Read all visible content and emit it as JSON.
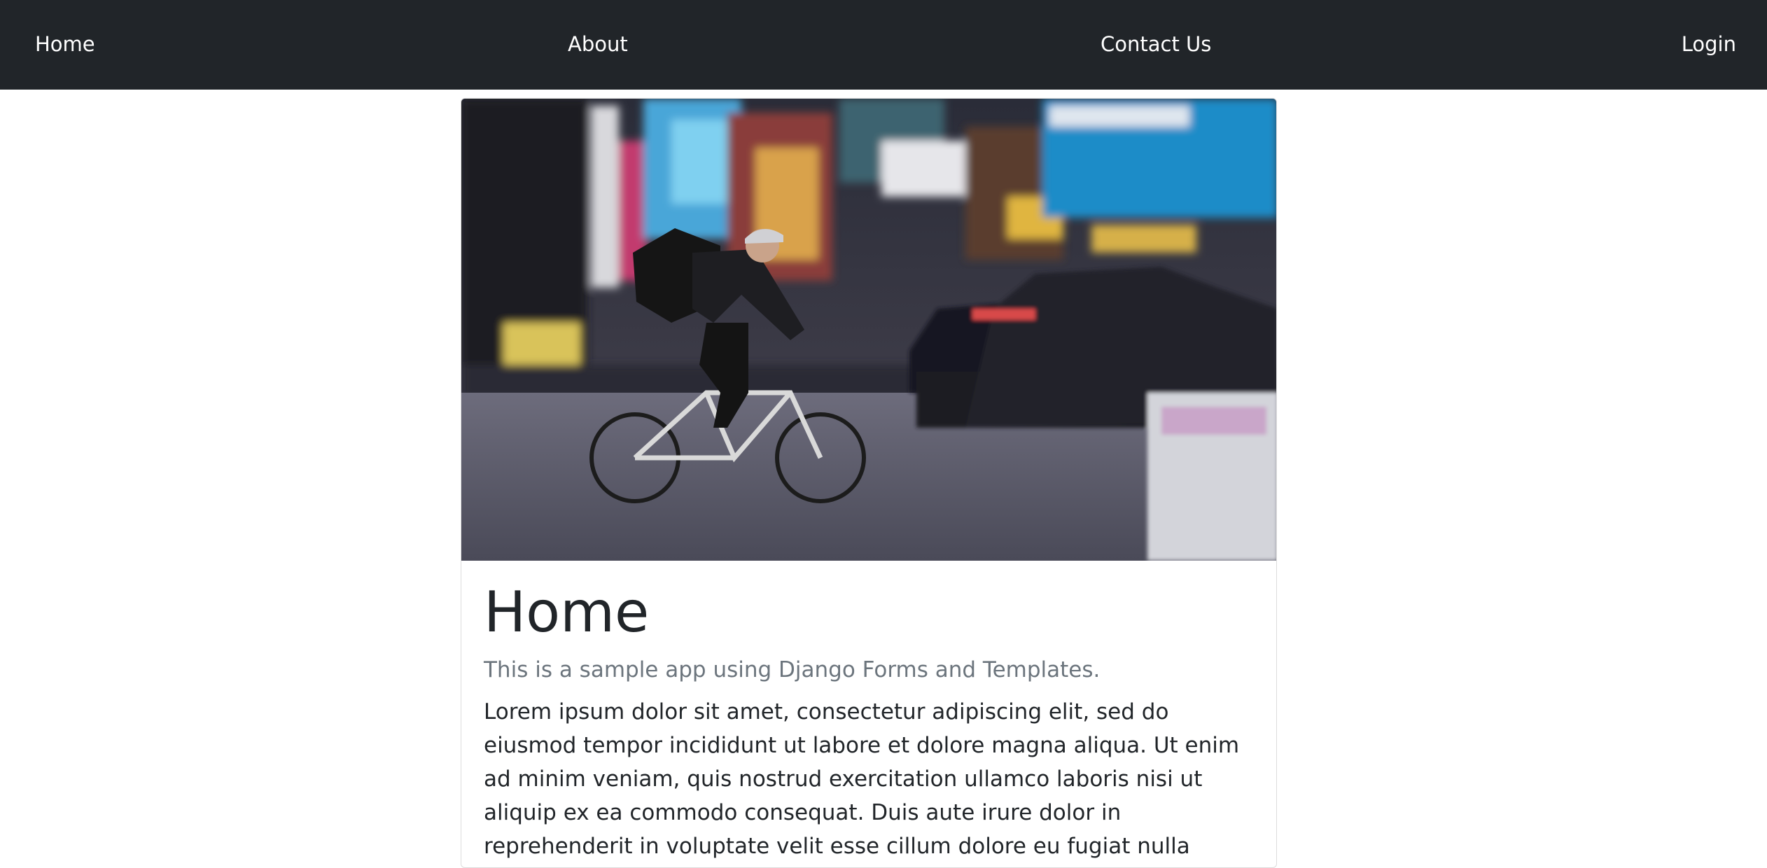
{
  "navbar": {
    "home": "Home",
    "about": "About",
    "contact": "Contact Us",
    "login": "Login"
  },
  "card": {
    "image_alt": "Cyclist riding through a blurred city street",
    "title": "Home",
    "subtitle": "This is a sample app using Django Forms and Templates.",
    "text": "Lorem ipsum dolor sit amet, consectetur adipiscing elit, sed do eiusmod tempor incididunt ut labore et dolore magna aliqua. Ut enim ad minim veniam, quis nostrud exercitation ullamco laboris nisi ut aliquip ex ea commodo consequat. Duis aute irure dolor in reprehenderit in voluptate velit esse cillum dolore eu fugiat nulla pariatur."
  },
  "colors": {
    "navbar_bg": "#212529",
    "nav_text": "#ffffff",
    "body_text": "#212529",
    "muted_text": "#6c757d"
  }
}
